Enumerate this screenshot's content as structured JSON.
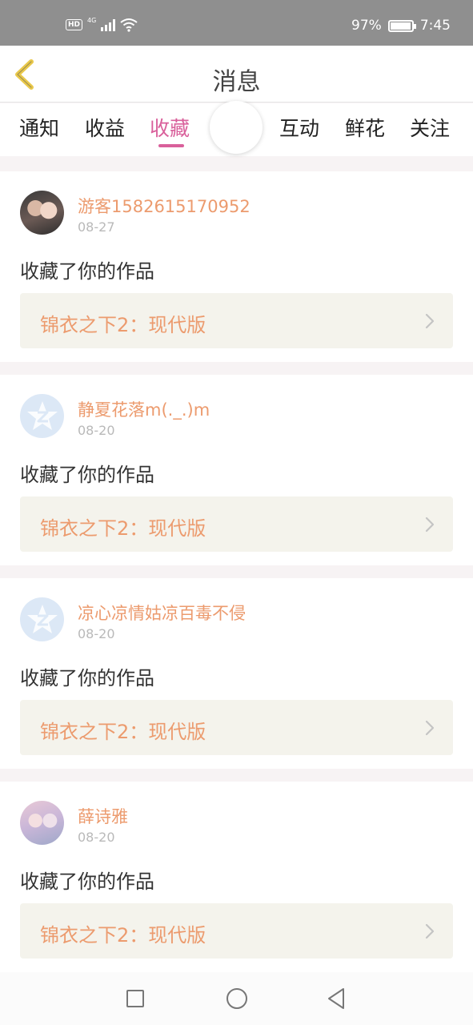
{
  "status_bar": {
    "hd": "HD",
    "network": "4G",
    "battery": "97%",
    "time": "7:45"
  },
  "header": {
    "title": "消息"
  },
  "tabs": [
    {
      "label": "通知",
      "active": false
    },
    {
      "label": "收益",
      "active": false
    },
    {
      "label": "收藏",
      "active": true
    },
    {
      "label": "互动",
      "active": false
    },
    {
      "label": "鲜花",
      "active": false
    },
    {
      "label": "关注",
      "active": false
    }
  ],
  "notifications": [
    {
      "user": "游客1582615170952",
      "date": "08-27",
      "action": "收藏了你的作品",
      "work": "锦衣之下2：现代版",
      "avatar": "photo"
    },
    {
      "user": "静夏花落m(._.)m",
      "date": "08-20",
      "action": "收藏了你的作品",
      "work": "锦衣之下2：现代版",
      "avatar": "default"
    },
    {
      "user": "凉心凉情姑凉百毒不侵",
      "date": "08-20",
      "action": "收藏了你的作品",
      "work": "锦衣之下2：现代版",
      "avatar": "default"
    },
    {
      "user": "薛诗雅",
      "date": "08-20",
      "action": "收藏了你的作品",
      "work": "锦衣之下2：现代版",
      "avatar": "photo"
    }
  ],
  "colors": {
    "accent_pink": "#d9609b",
    "accent_orange": "#ec9b6e",
    "back_icon": "#e9c84a"
  },
  "icons": {
    "back": "back-chevron-icon",
    "item_arrow": "chevron-right-icon",
    "nav_recents": "square-icon",
    "nav_home": "circle-icon",
    "nav_back": "triangle-back-icon"
  }
}
